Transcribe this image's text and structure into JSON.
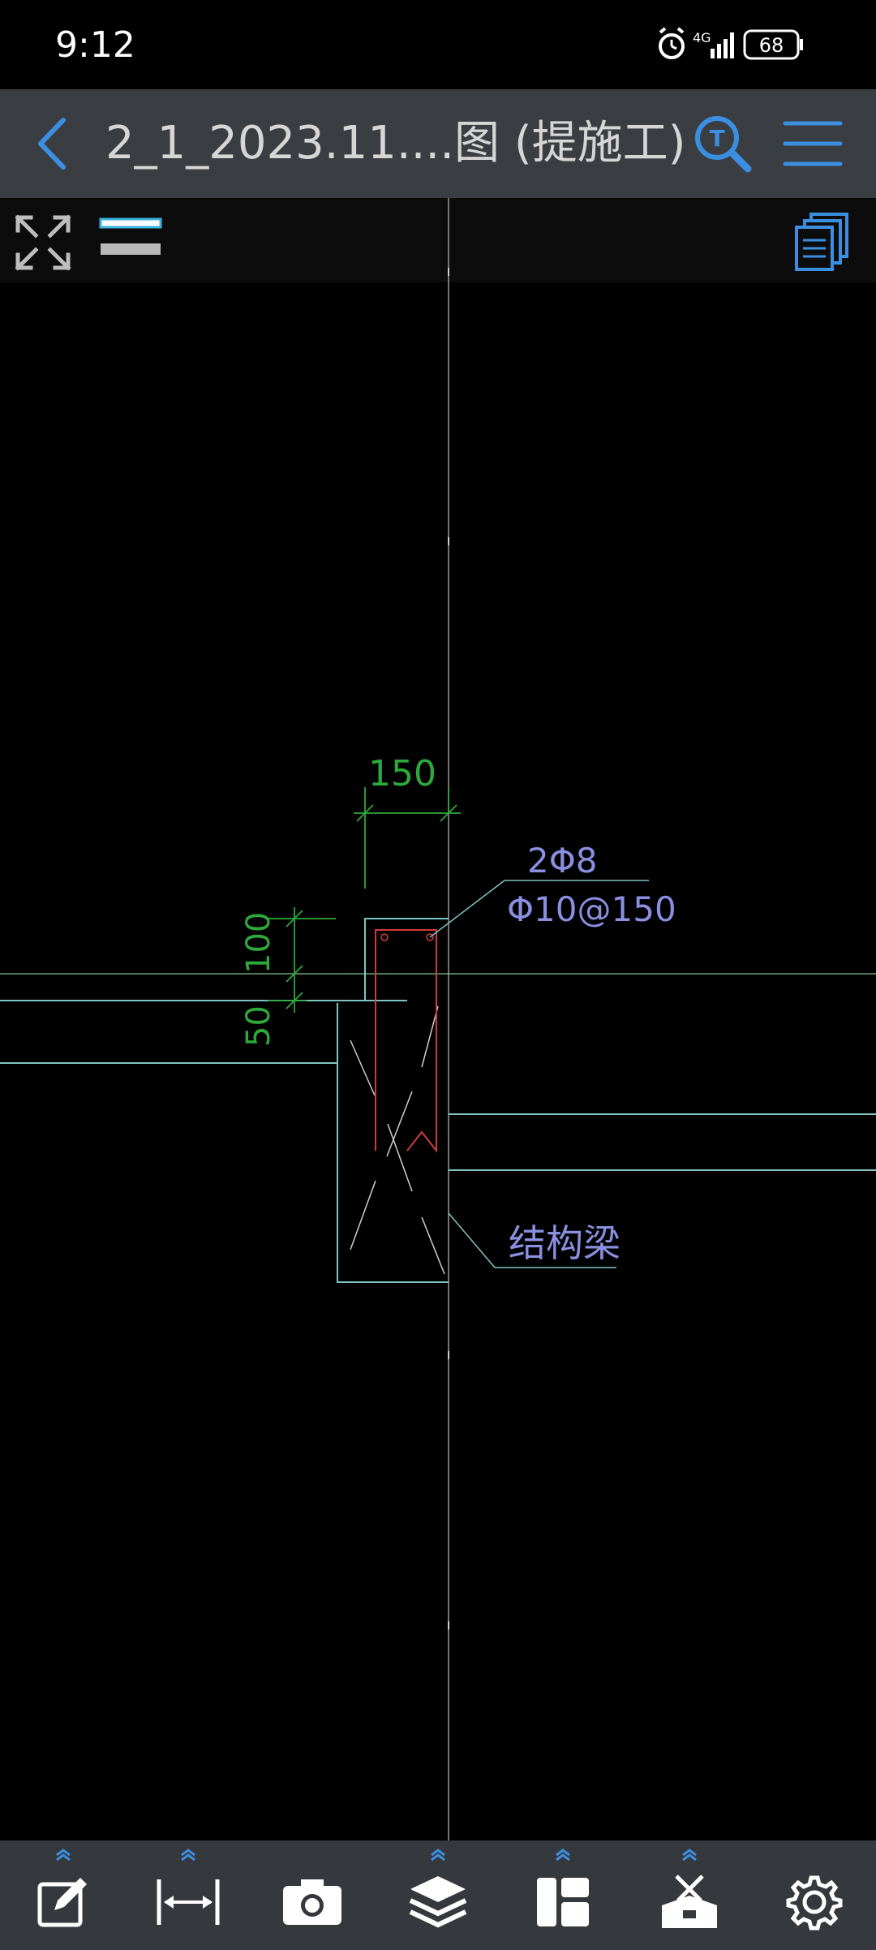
{
  "status_bar": {
    "time": "9:12",
    "network": "4G",
    "battery": "68"
  },
  "title_bar": {
    "title": "2_1_2023.11....图 (提施工)",
    "back_icon": "back-arrow-icon",
    "search_icon": "text-search-icon",
    "menu_icon": "hamburger-menu-icon"
  },
  "sub_toolbar": {
    "fullscreen_icon": "expand-arrows-icon",
    "layers_toggle_icon": "line-weight-icon",
    "pages_icon": "pages-stack-icon"
  },
  "drawing": {
    "dim_width": "150",
    "dim_height_top": "100",
    "dim_height_bottom": "50",
    "rebar_label_1": "2Φ8",
    "rebar_label_2": "Φ10@150",
    "beam_label": "结构梁"
  },
  "bottom_toolbar": {
    "tools": [
      "annotate-icon",
      "measure-icon",
      "camera-icon",
      "layers-icon",
      "layout-icon",
      "toolbox-icon",
      "settings-icon"
    ]
  },
  "colors": {
    "title_bar_bg": "#3a3d42",
    "accent_blue": "#3b8fe0",
    "cad_green": "#2ea83a",
    "cad_cyan": "#7fc4c4",
    "cad_red": "#d23a3a",
    "cad_label": "#8a8fe0"
  }
}
